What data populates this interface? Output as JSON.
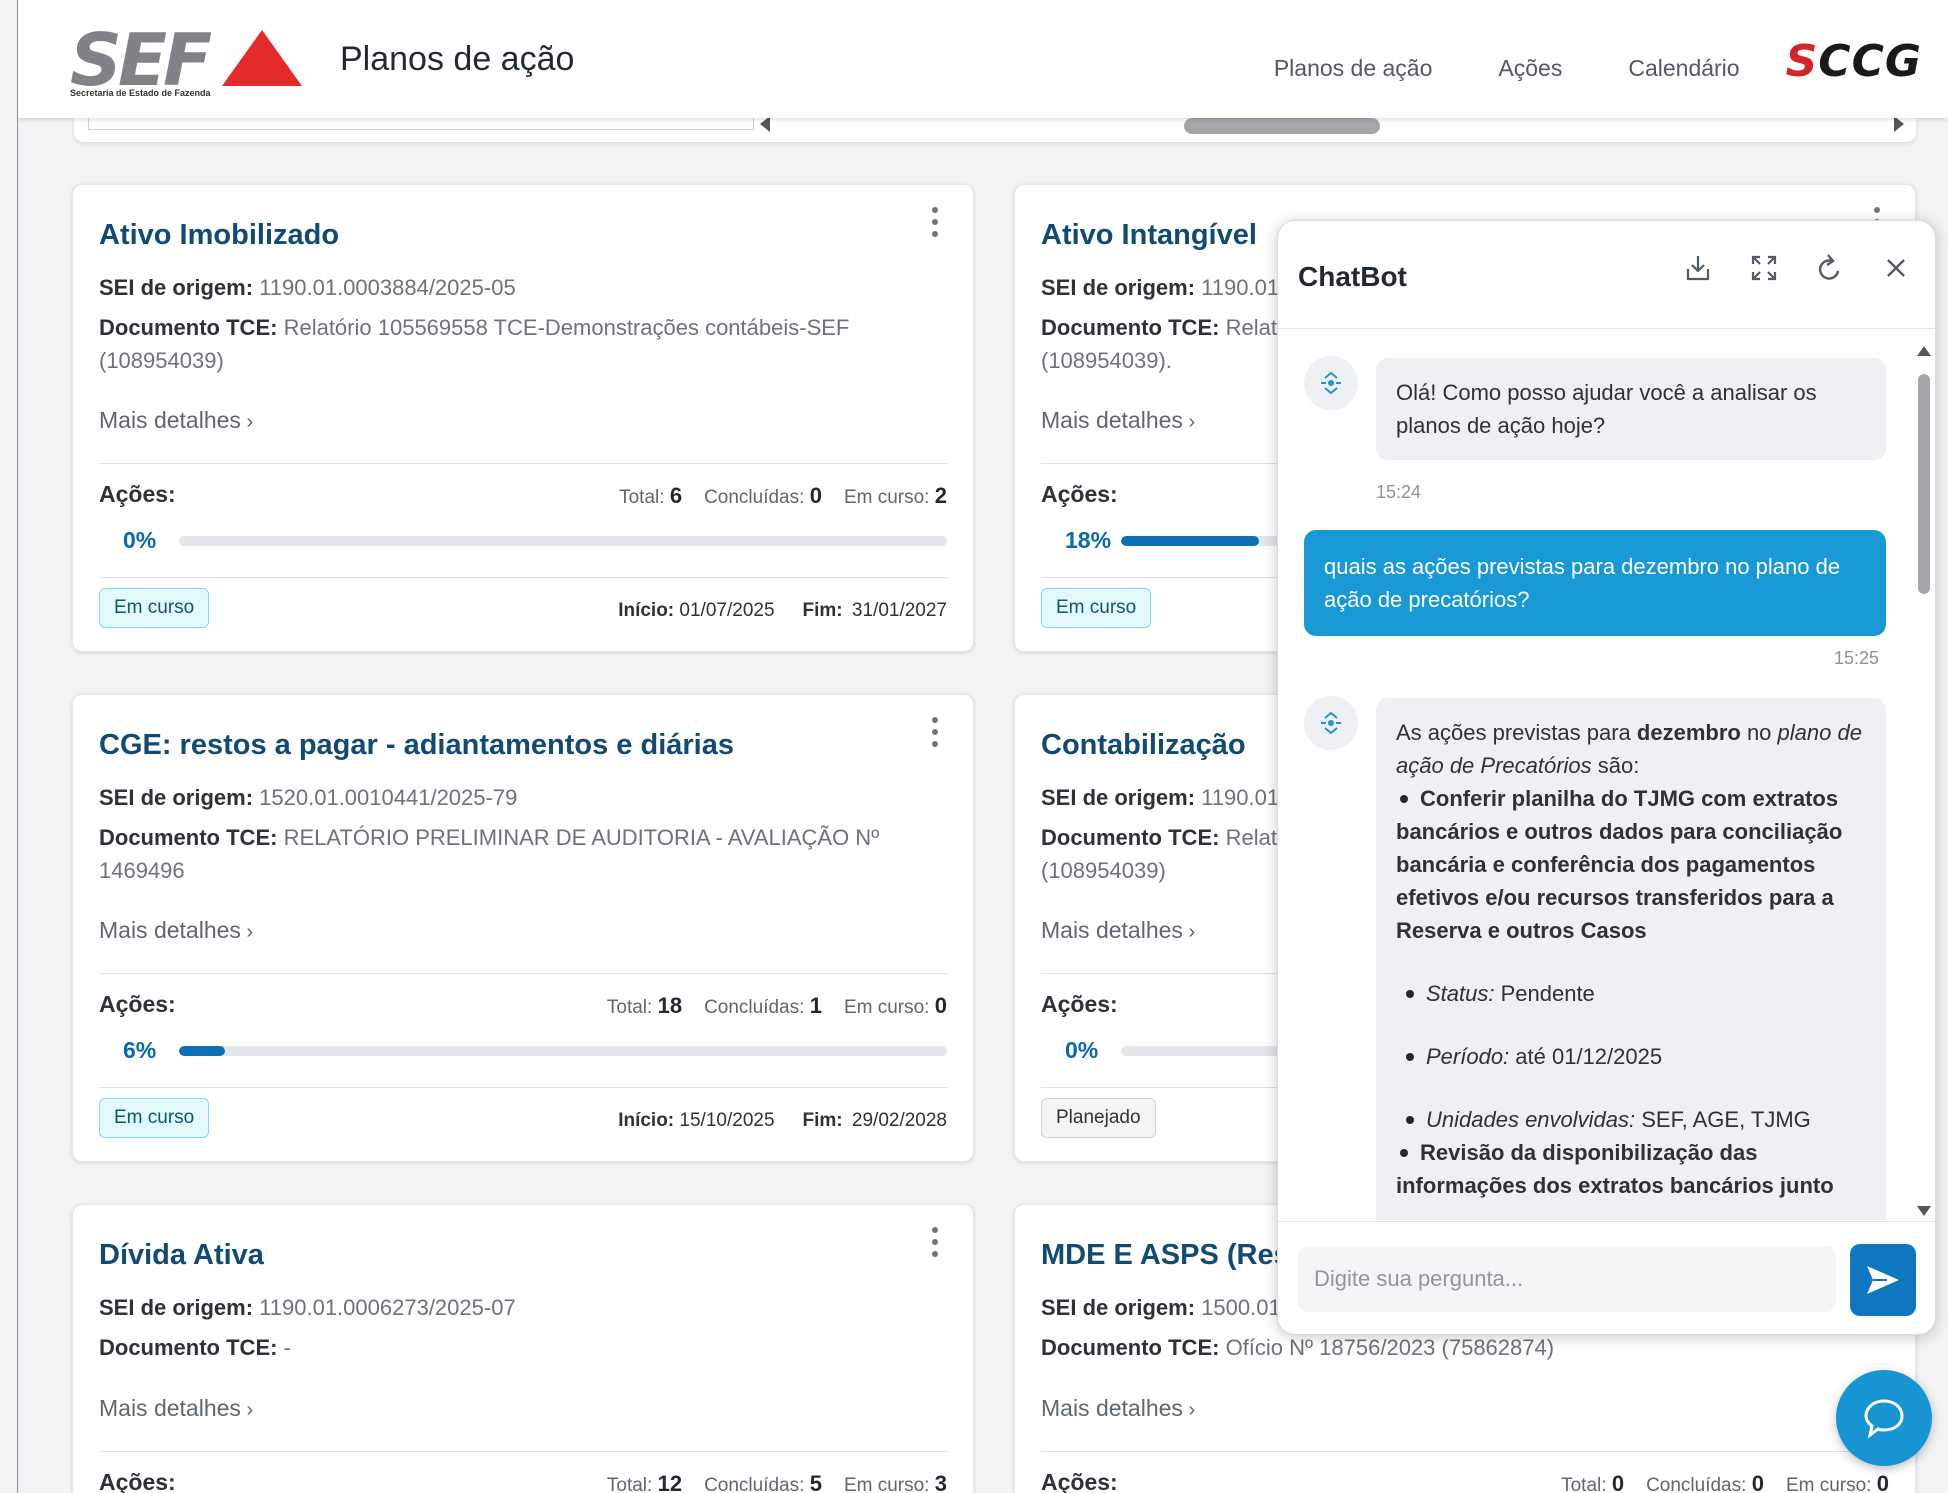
{
  "header": {
    "logo_text": "SEF",
    "logo_subtitle": "Secretaria de Estado de Fazenda",
    "title": "Planos de ação",
    "nav": [
      "Planos de ação",
      "Ações",
      "Calendário"
    ],
    "brand": "SCCG"
  },
  "labels": {
    "sei": "SEI de origem:",
    "tce": "Documento TCE:",
    "more": "Mais detalhes",
    "acoes": "Ações:",
    "total": "Total:",
    "concluidas": "Concluídas:",
    "em_curso": "Em curso:",
    "inicio": "Início:",
    "fim": "Fim:"
  },
  "cards": [
    {
      "title": "Ativo Imobilizado",
      "sei": "1190.01.0003884/2025-05",
      "tce": "Relatório 105569558 TCE-Demonstrações contábeis-SEF (108954039)",
      "total": "6",
      "concluidas": "0",
      "em_curso": "2",
      "percent_label": "0%",
      "progress": 0,
      "status": "Em curso",
      "inicio": "01/07/2025",
      "fim": "31/01/2027"
    },
    {
      "title": "Ativo Intangível",
      "sei": "1190.01",
      "tce": "Relat",
      "tce2": "(108954039).",
      "percent_label": "18%",
      "progress": 0.18,
      "status": "Em curso"
    },
    {
      "title": "CGE: restos a pagar - adiantamentos e diárias",
      "sei": "1520.01.0010441/2025-79",
      "tce": "RELATÓRIO PRELIMINAR DE AUDITORIA - AVALIAÇÃO Nº 1469496",
      "total": "18",
      "concluidas": "1",
      "em_curso": "0",
      "percent_label": "6%",
      "progress": 0.06,
      "status": "Em curso",
      "inicio": "15/10/2025",
      "fim": "29/02/2028"
    },
    {
      "title": "Contabilização",
      "sei": "1190.01",
      "tce": "Relat",
      "tce2": "(108954039)",
      "percent_label": "0%",
      "progress": 0,
      "status": "Planejado"
    },
    {
      "title": "Dívida Ativa",
      "sei": "1190.01.0006273/2025-07",
      "tce": "-",
      "total": "12",
      "concluidas": "5",
      "em_curso": "3"
    },
    {
      "title": "MDE E ASPS (Res",
      "sei": "1500.01",
      "tce": "Ofício Nº 18756/2023 (75862874)",
      "total": "0",
      "concluidas": "0",
      "em_curso": "0"
    }
  ],
  "chatbot": {
    "title": "ChatBot",
    "messages": [
      {
        "from": "bot",
        "text": "Olá! Como posso ajudar você a analisar os planos de ação hoje?",
        "time": "15:24"
      },
      {
        "from": "user",
        "text": "quais as ações previstas para dezembro no plano de ação de precatórios?",
        "time": "15:25"
      }
    ],
    "reply": {
      "p1": "As ações previstas para ",
      "p1b": "dezembro",
      "p1c": " no ",
      "p1i": "plano de ação de Precatórios",
      "p1d": " são:",
      "item1": "Conferir planilha do TJMG com extratos bancários e outros dados para conciliação bancária e conferência dos pagamentos efetivos e/ou recursos transferidos para a Reserva e outros Casos",
      "status_label": "Status:",
      "status_value": " Pendente",
      "periodo_label": "Período:",
      "periodo_value": " até 01/12/2025",
      "unidades_label": "Unidades envolvidas:",
      "unidades_value": " SEF, AGE, TJMG",
      "item2": "Revisão da disponibilização das informações dos extratos bancários junto"
    },
    "input_placeholder": "Digite sua pergunta..."
  }
}
